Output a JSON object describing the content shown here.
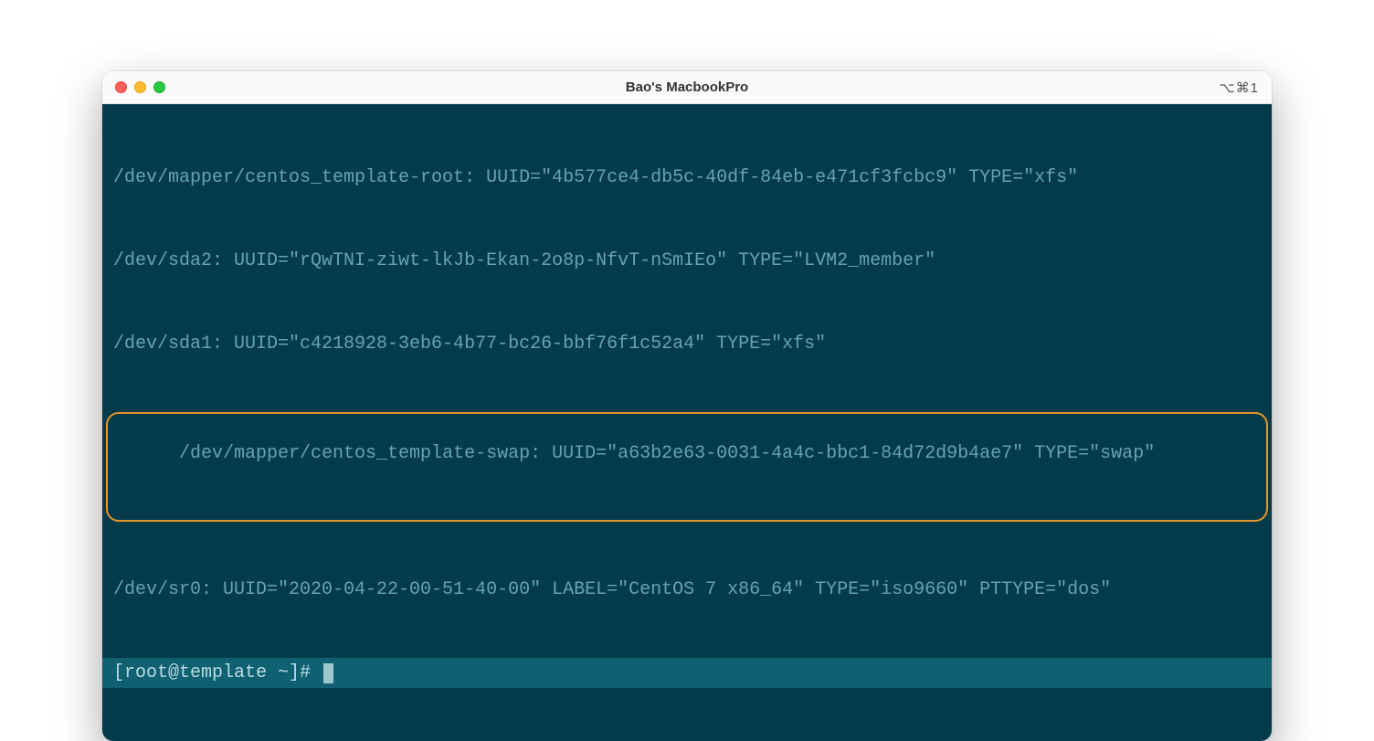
{
  "window": {
    "title": "Bao's MacbookPro",
    "tab_hint": "⌥⌘1"
  },
  "terminal": {
    "lines": [
      "/dev/mapper/centos_template-root: UUID=\"4b577ce4-db5c-40df-84eb-e471cf3fcbc9\" TYPE=\"xfs\"",
      "/dev/sda2: UUID=\"rQwTNI-ziwt-lkJb-Ekan-2o8p-NfvT-nSmIEo\" TYPE=\"LVM2_member\"",
      "/dev/sda1: UUID=\"c4218928-3eb6-4b77-bc26-bbf76f1c52a4\" TYPE=\"xfs\"",
      "/dev/mapper/centos_template-swap: UUID=\"a63b2e63-0031-4a4c-bbc1-84d72d9b4ae7\" TYPE=\"swap\"",
      "/dev/sr0: UUID=\"2020-04-22-00-51-40-00\" LABEL=\"CentOS 7 x86_64\" TYPE=\"iso9660\" PTTYPE=\"dos\""
    ],
    "highlighted_index": 3,
    "prompt": "[root@template ~]# "
  },
  "colors": {
    "terminal_bg": "#033b4a",
    "terminal_fg": "#66a3b0",
    "prompt_bg": "#0f6070",
    "highlight_ring": "#e7952a"
  }
}
